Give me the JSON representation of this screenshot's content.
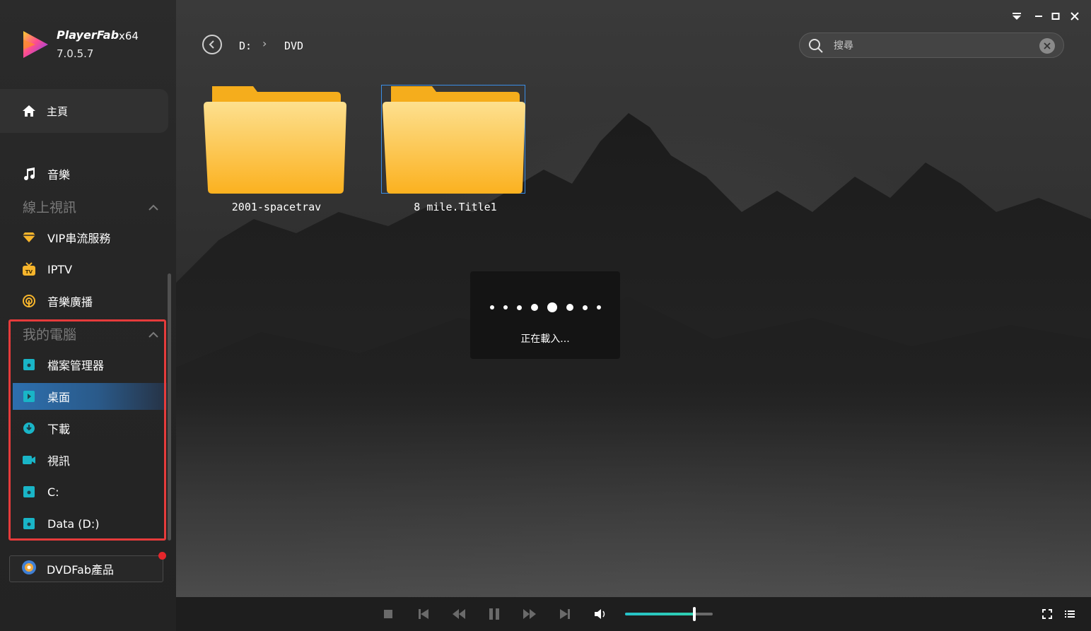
{
  "app": {
    "name": "PlayerFab",
    "arch": "x64",
    "version": "7.0.5.7"
  },
  "sidebar": {
    "home_label": "主頁",
    "music_label": "音樂",
    "online_section": "線上視訊",
    "online_items": [
      {
        "label": "VIP串流服務",
        "icon": "diamond-icon"
      },
      {
        "label": "IPTV",
        "icon": "tv-icon"
      },
      {
        "label": "音樂廣播",
        "icon": "podcast-icon"
      }
    ],
    "pc_section": "我的電腦",
    "pc_items": [
      {
        "label": "檔案管理器",
        "icon": "file-manager-icon"
      },
      {
        "label": "桌面",
        "icon": "desktop-icon",
        "active": true
      },
      {
        "label": "下載",
        "icon": "download-icon"
      },
      {
        "label": "視訊",
        "icon": "video-icon"
      },
      {
        "label": "C:",
        "icon": "drive-icon"
      },
      {
        "label": "Data (D:)",
        "icon": "drive-icon"
      }
    ],
    "dvdfab_label": "DVDFab產品"
  },
  "breadcrumb": {
    "drive": "D:",
    "separator": "›",
    "folder": "DVD"
  },
  "search": {
    "placeholder": "搜尋",
    "value": ""
  },
  "folders": [
    {
      "name": "2001-spacetrav",
      "selected": false
    },
    {
      "name": "8 mile.Title1",
      "selected": true
    }
  ],
  "loading": {
    "text": "正在載入..."
  },
  "player": {
    "volume_fraction": 0.79
  },
  "colors": {
    "accent": "#2d6fae",
    "highlight_frame": "#e63b3b",
    "folder_yellow": "#fbbf2b",
    "volume": "#26c2c9"
  }
}
